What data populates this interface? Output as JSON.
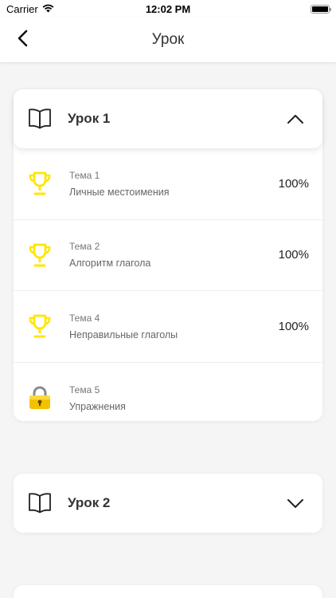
{
  "status_bar": {
    "carrier": "Carrier",
    "time": "12:02 PM"
  },
  "header": {
    "title": "Урок"
  },
  "lessons": [
    {
      "title": "Урок 1",
      "expanded": true,
      "topics": [
        {
          "number": "Тема 1",
          "name": "Личные местоимения",
          "progress": "100%",
          "icon": "trophy-icon"
        },
        {
          "number": "Тема 2",
          "name": "Алгоритм глагола",
          "progress": "100%",
          "icon": "trophy-icon"
        },
        {
          "number": "Тема 4",
          "name": "Неправильные глаголы",
          "progress": "100%",
          "icon": "trophy-icon"
        },
        {
          "number": "Тема 5",
          "name": "Упражнения",
          "progress": "",
          "icon": "lock-icon"
        }
      ]
    },
    {
      "title": "Урок 2",
      "expanded": false
    }
  ],
  "colors": {
    "trophy": "#FFE600",
    "lock": "#F2C200",
    "background": "#F5F5F5"
  }
}
